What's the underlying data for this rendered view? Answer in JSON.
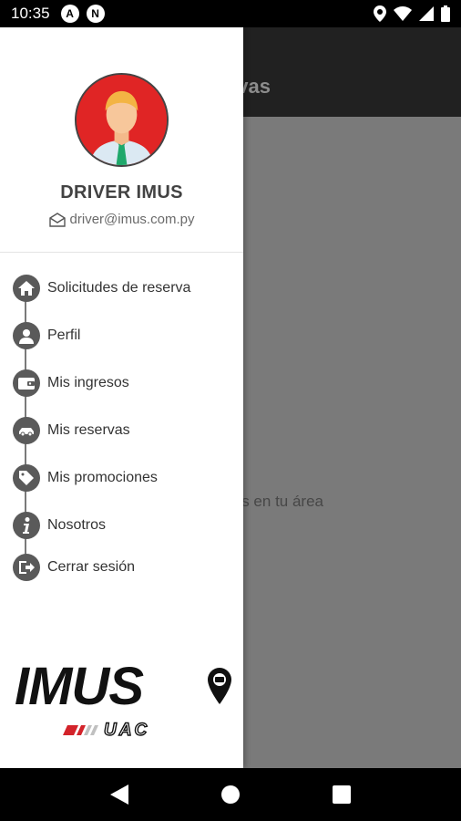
{
  "status_bar": {
    "time": "10:35",
    "notif_icon_1": "A",
    "notif_icon_2": "N"
  },
  "app": {
    "title_fragment": "eservas",
    "empty_text_fragment": "basajeros en tu área"
  },
  "drawer": {
    "driver_name": "DRIVER IMUS",
    "driver_email": "driver@imus.com.py",
    "menu_items": [
      {
        "label": "Solicitudes de reserva",
        "icon": "home-icon"
      },
      {
        "label": "Perfil",
        "icon": "person-icon"
      },
      {
        "label": "Mis ingresos",
        "icon": "wallet-icon"
      },
      {
        "label": "Mis reservas",
        "icon": "car-icon"
      },
      {
        "label": "Mis promociones",
        "icon": "tag-icon"
      },
      {
        "label": "Nosotros",
        "icon": "info-icon"
      },
      {
        "label": "Cerrar sesión",
        "icon": "logout-icon"
      }
    ],
    "logo": {
      "brand": "IMUS",
      "sub": "UAC"
    }
  },
  "colors": {
    "avatar_bg": "#e02525",
    "logo_red": "#d3232a",
    "icon_gray": "#5a5a5a"
  }
}
